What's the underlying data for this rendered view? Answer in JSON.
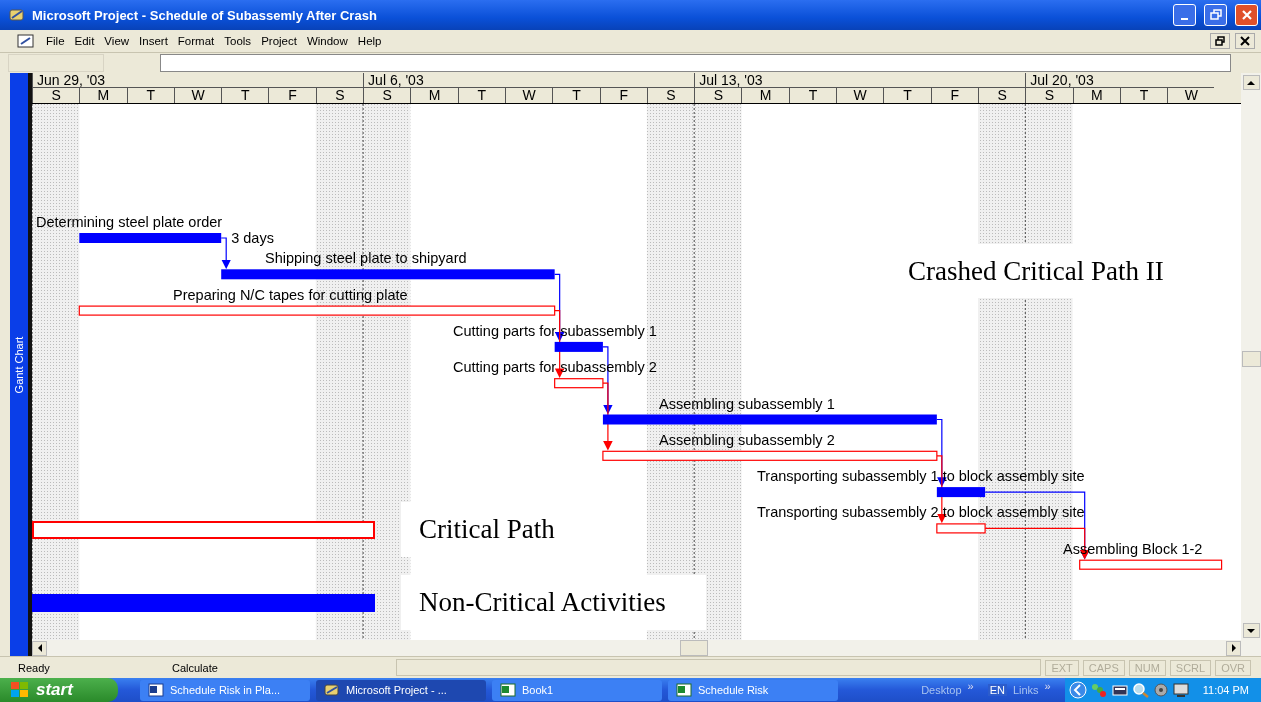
{
  "window": {
    "title": "Microsoft Project - Schedule of Subassemly After Crash"
  },
  "menu": [
    {
      "label": "File"
    },
    {
      "label": "Edit"
    },
    {
      "label": "View"
    },
    {
      "label": "Insert"
    },
    {
      "label": "Format"
    },
    {
      "label": "Tools"
    },
    {
      "label": "Project"
    },
    {
      "label": "Window"
    },
    {
      "label": "Help"
    }
  ],
  "view_bar": {
    "label": "Gantt Chart"
  },
  "timescale": [
    {
      "label": "Jun 29, '03",
      "days": [
        "S",
        "M",
        "T",
        "W",
        "T",
        "F",
        "S"
      ]
    },
    {
      "label": "Jul 6, '03",
      "days": [
        "S",
        "M",
        "T",
        "W",
        "T",
        "F",
        "S"
      ]
    },
    {
      "label": "Jul 13, '03",
      "days": [
        "S",
        "M",
        "T",
        "W",
        "T",
        "F",
        "S"
      ]
    },
    {
      "label": "Jul 20, '03",
      "days": [
        "S",
        "M",
        "T",
        "W"
      ]
    }
  ],
  "tasks": [
    {
      "label": "Determining steel plate order",
      "critical": false,
      "note": "3 days"
    },
    {
      "label": "Shipping steel plate to shipyard",
      "critical": false
    },
    {
      "label": "Preparing N/C tapes for cutting plate",
      "critical": true
    },
    {
      "label": "Cutting parts for subassembly 1",
      "critical": false
    },
    {
      "label": "Cutting parts for subassembly 2",
      "critical": true
    },
    {
      "label": "Assembling subassembly 1",
      "critical": false
    },
    {
      "label": "Assembling subassembly 2",
      "critical": true
    },
    {
      "label": "Transporting subassembly 1 to block assembly site",
      "critical": false
    },
    {
      "label": "Transporting subassembly 2 to block assembly site",
      "critical": true
    },
    {
      "label": "Assembling Block 1-2",
      "critical": true
    }
  ],
  "overlay_title": "Crashed Critical Path II",
  "legend": [
    {
      "label": "Critical Path",
      "critical": true
    },
    {
      "label": "Non-Critical Activities",
      "critical": false
    }
  ],
  "status_bar": {
    "mode": "Ready",
    "message": "Calculate",
    "indicators": [
      {
        "label": "EXT",
        "on": false
      },
      {
        "label": "CAPS",
        "on": false
      },
      {
        "label": "NUM",
        "on": false
      },
      {
        "label": "SCRL",
        "on": false
      },
      {
        "label": "OVR",
        "on": false
      }
    ]
  },
  "taskbar": {
    "start": "start",
    "tasks": [
      {
        "label": "Schedule Risk in Pla...",
        "kind": "word",
        "selected": false
      },
      {
        "label": "Microsoft Project - ...",
        "kind": "project",
        "selected": true
      },
      {
        "label": "Book1",
        "kind": "excel",
        "selected": false
      },
      {
        "label": "Schedule Risk",
        "kind": "excel",
        "selected": false
      }
    ],
    "toolbars": [
      {
        "label": "Desktop",
        "chevron": "»"
      },
      {
        "label": "EN"
      },
      {
        "label": "Links",
        "chevron": "»"
      }
    ],
    "clock": "11:04 PM"
  }
}
